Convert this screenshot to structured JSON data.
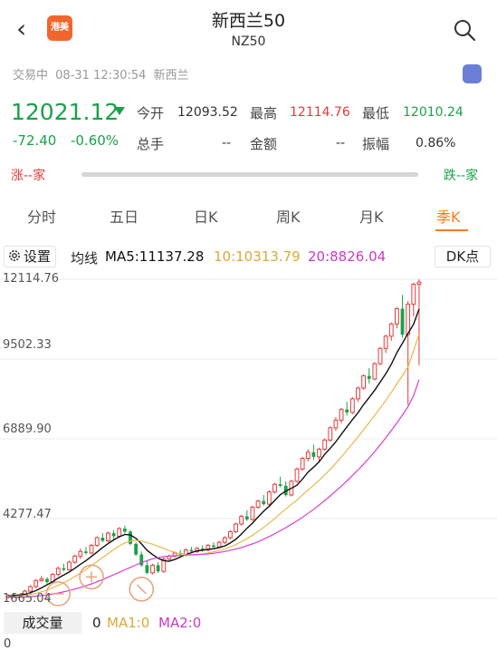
{
  "header": {
    "title": "新西兰50",
    "subtitle": "NZ50",
    "logo_text": "港美"
  },
  "status": {
    "state": "交易中",
    "datetime": "08-31 12:30:54",
    "market": "新西兰"
  },
  "quote": {
    "price": "12021.12",
    "change": "-72.40",
    "change_pct": "-0.60%",
    "open_label": "今开",
    "open": "12093.52",
    "high_label": "最高",
    "high": "12114.76",
    "low_label": "最低",
    "low": "12010.24",
    "volume_label": "总手",
    "volume": "--",
    "amount_label": "金额",
    "amount": "--",
    "amplitude_label": "振幅",
    "amplitude": "0.86%",
    "up_label": "涨--家",
    "down_label": "跌--家"
  },
  "tabs": [
    "分时",
    "五日",
    "日K",
    "周K",
    "月K",
    "季K"
  ],
  "active_tab": "季K",
  "ma_bar": {
    "settings": "设置",
    "ma_title": "均线",
    "ma5": "MA5:11137.28",
    "ma10": "10:10313.79",
    "ma20": "20:8826.04",
    "dk": "DK点"
  },
  "chart_data": {
    "type": "candlestick",
    "y_ticks": [
      "12114.76",
      "9502.33",
      "6889.90",
      "4277.47",
      "1665.04"
    ],
    "ylim": [
      1665.04,
      12114.76
    ],
    "ohlc": [
      [
        1700,
        1800,
        1665,
        1760
      ],
      [
        1760,
        1850,
        1700,
        1720
      ],
      [
        1720,
        1800,
        1690,
        1780
      ],
      [
        1780,
        1950,
        1750,
        1900
      ],
      [
        1900,
        2100,
        1850,
        2050
      ],
      [
        2050,
        2300,
        2000,
        2250
      ],
      [
        2250,
        2400,
        2200,
        2300
      ],
      [
        2300,
        2350,
        2150,
        2200
      ],
      [
        2200,
        2500,
        2180,
        2450
      ],
      [
        2450,
        2700,
        2400,
        2650
      ],
      [
        2650,
        2800,
        2550,
        2600
      ],
      [
        2600,
        2900,
        2580,
        2850
      ],
      [
        2850,
        3100,
        2800,
        3050
      ],
      [
        3050,
        3300,
        2950,
        3200
      ],
      [
        3200,
        3350,
        3100,
        3150
      ],
      [
        3150,
        3450,
        3100,
        3400
      ],
      [
        3400,
        3700,
        3350,
        3650
      ],
      [
        3650,
        3800,
        3500,
        3550
      ],
      [
        3550,
        3850,
        3500,
        3800
      ],
      [
        3800,
        3900,
        3600,
        3700
      ],
      [
        3700,
        4000,
        3650,
        3950
      ],
      [
        3950,
        4050,
        3800,
        3850
      ],
      [
        3850,
        3900,
        3400,
        3450
      ],
      [
        3450,
        3500,
        3050,
        3100
      ],
      [
        3100,
        3200,
        2700,
        2750
      ],
      [
        2750,
        2900,
        2450,
        2500
      ],
      [
        2500,
        2800,
        2450,
        2750
      ],
      [
        2750,
        2850,
        2500,
        2550
      ],
      [
        2550,
        3000,
        2500,
        2950
      ],
      [
        2950,
        3100,
        2900,
        3050
      ],
      [
        3050,
        3200,
        3000,
        3150
      ],
      [
        3150,
        3250,
        3050,
        3100
      ],
      [
        3100,
        3300,
        3050,
        3250
      ],
      [
        3250,
        3350,
        3150,
        3200
      ],
      [
        3200,
        3350,
        3150,
        3300
      ],
      [
        3300,
        3400,
        3200,
        3250
      ],
      [
        3250,
        3450,
        3200,
        3400
      ],
      [
        3400,
        3500,
        3300,
        3350
      ],
      [
        3350,
        3550,
        3300,
        3500
      ],
      [
        3500,
        3700,
        3450,
        3650
      ],
      [
        3650,
        3900,
        3600,
        3850
      ],
      [
        3850,
        4150,
        3800,
        4100
      ],
      [
        4100,
        4400,
        4050,
        4350
      ],
      [
        4350,
        4550,
        4200,
        4250
      ],
      [
        4250,
        4700,
        4200,
        4650
      ],
      [
        4650,
        4900,
        4600,
        4850
      ],
      [
        4850,
        5050,
        4700,
        4750
      ],
      [
        4750,
        5200,
        4700,
        5150
      ],
      [
        5150,
        5450,
        5100,
        5400
      ],
      [
        5400,
        5650,
        5300,
        5350
      ],
      [
        5350,
        5500,
        5000,
        5050
      ],
      [
        5050,
        5550,
        5000,
        5500
      ],
      [
        5500,
        5950,
        5450,
        5900
      ],
      [
        5900,
        6300,
        5850,
        6250
      ],
      [
        6250,
        6550,
        6150,
        6450
      ],
      [
        6450,
        6700,
        6200,
        6300
      ],
      [
        6300,
        6600,
        6150,
        6550
      ],
      [
        6550,
        6900,
        6500,
        6850
      ],
      [
        6850,
        7300,
        6800,
        7250
      ],
      [
        7250,
        7600,
        7150,
        7500
      ],
      [
        7500,
        7900,
        7400,
        7850
      ],
      [
        7850,
        8100,
        7650,
        7750
      ],
      [
        7750,
        8250,
        7700,
        8200
      ],
      [
        8200,
        8600,
        8100,
        8550
      ],
      [
        8550,
        9000,
        8500,
        8950
      ],
      [
        8950,
        9200,
        8700,
        8850
      ],
      [
        8850,
        9400,
        8800,
        9350
      ],
      [
        9350,
        9900,
        9300,
        9850
      ],
      [
        9850,
        10300,
        9700,
        10250
      ],
      [
        10250,
        10700,
        10100,
        10650
      ],
      [
        10650,
        11200,
        10500,
        11150
      ],
      [
        11150,
        11600,
        10200,
        10300
      ],
      [
        10300,
        11400,
        8000,
        11300
      ],
      [
        11300,
        12000,
        10900,
        11950
      ],
      [
        11950,
        12114.76,
        9300,
        12021.12
      ]
    ],
    "series": [
      {
        "name": "MA5",
        "values": [
          1740,
          1760,
          1770,
          1800,
          1850,
          1920,
          2010,
          2110,
          2210,
          2330,
          2430,
          2530,
          2650,
          2780,
          2900,
          3040,
          3180,
          3330,
          3460,
          3580,
          3680,
          3760,
          3740,
          3630,
          3450,
          3240,
          3100,
          2980,
          2900,
          2880,
          2940,
          3020,
          3100,
          3160,
          3220,
          3240,
          3270,
          3290,
          3330,
          3380,
          3480,
          3600,
          3770,
          3960,
          4130,
          4330,
          4520,
          4680,
          4870,
          5060,
          5180,
          5270,
          5370,
          5570,
          5800,
          5960,
          6140,
          6380,
          6580,
          6790,
          7040,
          7280,
          7520,
          7740,
          8010,
          8240,
          8480,
          8750,
          9020,
          9330,
          9710,
          10020,
          10340,
          10640,
          11137.28
        ]
      },
      {
        "name": "MA10",
        "values": [
          1720,
          1730,
          1745,
          1760,
          1790,
          1830,
          1880,
          1940,
          2010,
          2090,
          2180,
          2270,
          2380,
          2490,
          2610,
          2740,
          2870,
          3000,
          3130,
          3260,
          3380,
          3480,
          3540,
          3560,
          3540,
          3490,
          3440,
          3370,
          3300,
          3230,
          3170,
          3130,
          3100,
          3090,
          3090,
          3120,
          3150,
          3190,
          3230,
          3280,
          3350,
          3430,
          3520,
          3620,
          3730,
          3860,
          3990,
          4130,
          4280,
          4440,
          4590,
          4740,
          4880,
          5050,
          5210,
          5370,
          5530,
          5710,
          5890,
          6090,
          6300,
          6510,
          6730,
          6950,
          7180,
          7420,
          7660,
          7900,
          8150,
          8410,
          8690,
          8960,
          9240,
          9770,
          10313.79
        ]
      },
      {
        "name": "MA20",
        "values": [
          1700,
          1700,
          1705,
          1710,
          1720,
          1740,
          1760,
          1780,
          1810,
          1840,
          1880,
          1920,
          1970,
          2020,
          2080,
          2140,
          2210,
          2280,
          2360,
          2440,
          2520,
          2600,
          2680,
          2760,
          2840,
          2900,
          2960,
          3000,
          3030,
          3050,
          3060,
          3070,
          3080,
          3090,
          3100,
          3110,
          3120,
          3140,
          3170,
          3200,
          3240,
          3280,
          3330,
          3390,
          3450,
          3520,
          3600,
          3690,
          3780,
          3880,
          3980,
          4090,
          4200,
          4320,
          4450,
          4580,
          4720,
          4870,
          5020,
          5180,
          5340,
          5510,
          5690,
          5870,
          6060,
          6260,
          6470,
          6690,
          6920,
          7160,
          7410,
          7670,
          7940,
          8300,
          8826.04
        ]
      }
    ],
    "colors": {
      "up": "#e23c3c",
      "down": "#1aa14b",
      "ma5": "#111111",
      "ma10": "#e6b84a",
      "ma20": "#d63fd0",
      "annotation": "#e8a07a"
    }
  },
  "volume": {
    "button": "成交量",
    "value": "0",
    "ma1": "MA1:0",
    "ma2": "MA2:0",
    "axis_zero": "0"
  }
}
